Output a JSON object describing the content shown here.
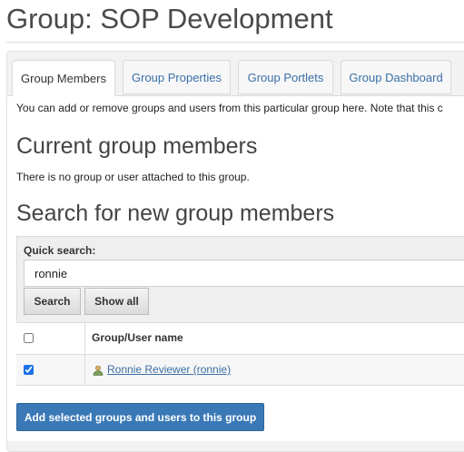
{
  "page": {
    "title": "Group: SOP Development"
  },
  "tabs": [
    {
      "label": "Group Members",
      "active": true
    },
    {
      "label": "Group Properties",
      "active": false
    },
    {
      "label": "Group Portlets",
      "active": false
    },
    {
      "label": "Group Dashboard",
      "active": false
    }
  ],
  "intro": "You can add or remove groups and users from this particular group here. Note that this c",
  "current_members": {
    "heading": "Current group members",
    "empty_note": "There is no group or user attached to this group."
  },
  "search": {
    "heading": "Search for new group members",
    "label": "Quick search:",
    "value": "ronnie",
    "search_button": "Search",
    "show_all_button": "Show all"
  },
  "results": {
    "column_header": "Group/User name",
    "rows": [
      {
        "name": "Ronnie Reviewer (ronnie)",
        "checked": true,
        "icon": "user-icon"
      }
    ]
  },
  "add_button": "Add selected groups and users to this group",
  "colors": {
    "link": "#3a6fa8",
    "primary_button": "#3a79b6"
  }
}
